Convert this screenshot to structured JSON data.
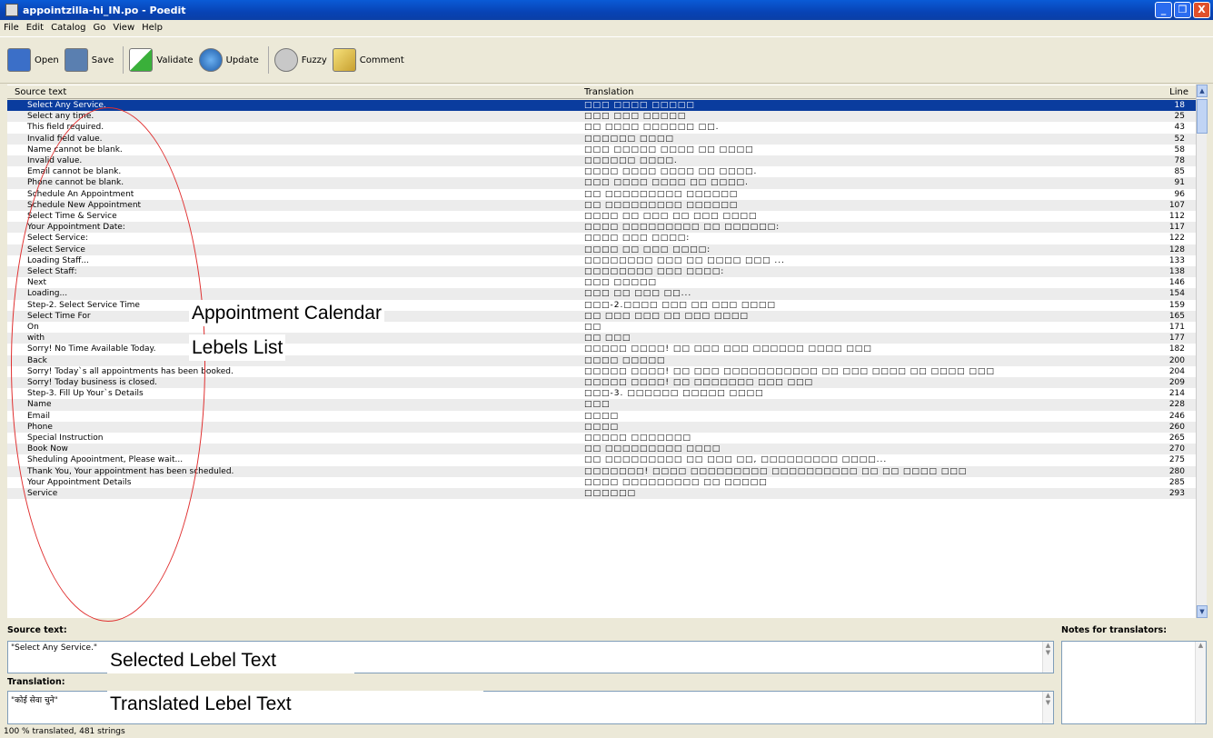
{
  "window": {
    "title": "appointzilla-hi_IN.po - Poedit",
    "controls": [
      "_",
      "❒",
      "X"
    ]
  },
  "menu": [
    "File",
    "Edit",
    "Catalog",
    "Go",
    "View",
    "Help"
  ],
  "toolbar": [
    {
      "label": "Open",
      "icon": "open-folder-icon",
      "cls": "open"
    },
    {
      "label": "Save",
      "icon": "save-icon",
      "cls": "save"
    },
    {
      "label": "Validate",
      "icon": "validate-check-icon",
      "cls": "validate",
      "sep": true
    },
    {
      "label": "Update",
      "icon": "update-globe-icon",
      "cls": "update"
    },
    {
      "label": "Fuzzy",
      "icon": "fuzzy-cloud-icon",
      "cls": "fuzzy",
      "sep": true
    },
    {
      "label": "Comment",
      "icon": "comment-pencil-icon",
      "cls": "comment"
    }
  ],
  "columns": {
    "source": "Source text",
    "translation": "Translation",
    "line": "Line"
  },
  "rows": [
    {
      "src": "Select Any Service.",
      "trn": "□□□ □□□□ □□□□□",
      "ln": "18",
      "selected": true
    },
    {
      "src": "Select any time.",
      "trn": "□□□ □□□ □□□□□",
      "ln": "25"
    },
    {
      "src": "This field required.",
      "trn": "□□ □□□□ □□□□□□ □□.",
      "ln": "43"
    },
    {
      "src": "Invalid field value.",
      "trn": "□□□□□□ □□□□",
      "ln": "52"
    },
    {
      "src": "Name cannot be blank.",
      "trn": "□□□ □□□□□ □□□□ □□ □□□□",
      "ln": "58"
    },
    {
      "src": "Invalid value.",
      "trn": "□□□□□□ □□□□.",
      "ln": "78"
    },
    {
      "src": "Email cannot be blank.",
      "trn": "□□□□ □□□□ □□□□ □□ □□□□.",
      "ln": "85"
    },
    {
      "src": "Phone cannot be blank.",
      "trn": "□□□ □□□□ □□□□ □□ □□□□.",
      "ln": "91"
    },
    {
      "src": "Schedule An Appointment",
      "trn": "□□ □□□□□□□□□ □□□□□□",
      "ln": "96"
    },
    {
      "src": "Schedule New Appointment",
      "trn": "□□ □□□□□□□□□ □□□□□□",
      "ln": "107"
    },
    {
      "src": "Select Time & Service",
      "trn": "□□□□ □□ □□□  □□ □□□ □□□□",
      "ln": "112"
    },
    {
      "src": "Your Appointment Date:",
      "trn": "□□□□ □□□□□□□□□ □□ □□□□□□:",
      "ln": "117"
    },
    {
      "src": "Select Service:",
      "trn": "□□□□ □□□ □□□□:",
      "ln": "122"
    },
    {
      "src": "Select Service",
      "trn": "□□□□ □□ □□□ □□□□:",
      "ln": "128"
    },
    {
      "src": "Loading Staff...",
      "trn": "□□□□□□□□ □□□ □□ □□□□ □□□ ...",
      "ln": "133"
    },
    {
      "src": "Select Staff:",
      "trn": "□□□□□□□□ □□□ □□□□:",
      "ln": "138"
    },
    {
      "src": "Next",
      "trn": "□□□ □□□□□",
      "ln": "146"
    },
    {
      "src": "Loading...",
      "trn": "□□□ □□ □□□ □□...",
      "ln": "154"
    },
    {
      "src": "Step-2. Select Service Time",
      "trn": "□□□-2.□□□□ □□□ □□ □□□ □□□□",
      "ln": "159"
    },
    {
      "src": "Select Time For",
      "trn": "□□ □□□ □□□ □□ □□□ □□□□",
      "ln": "165"
    },
    {
      "src": "On",
      "trn": "□□",
      "ln": "171"
    },
    {
      "src": "with",
      "trn": "□□ □□□",
      "ln": "177"
    },
    {
      "src": "Sorry! No Time Available Today.",
      "trn": "□□□□□ □□□□! □□ □□□ □□□ □□□□□□ □□□□ □□□",
      "ln": "182"
    },
    {
      "src": "Back",
      "trn": "□□□□ □□□□□",
      "ln": "200"
    },
    {
      "src": "Sorry! Today`s all appointments has been booked.",
      "trn": "□□□□□ □□□□! □□ □□□ □□□□□□□□□□□ □□ □□□ □□□□ □□ □□□□ □□□",
      "ln": "204"
    },
    {
      "src": "Sorry! Today business is closed.",
      "trn": "□□□□□ □□□□! □□ □□□□□□□ □□□ □□□",
      "ln": "209"
    },
    {
      "src": "Step-3. Fill Up Your`s Details",
      "trn": "□□□-3. □□□□□□ □□□□□ □□□□",
      "ln": "214"
    },
    {
      "src": "Name",
      "trn": "□□□",
      "ln": "228"
    },
    {
      "src": "Email",
      "trn": "□□□□",
      "ln": "246"
    },
    {
      "src": "Phone",
      "trn": "□□□□",
      "ln": "260"
    },
    {
      "src": "Special Instruction",
      "trn": "□□□□□ □□□□□□□",
      "ln": "265"
    },
    {
      "src": "Book Now",
      "trn": "□□ □□□□□□□□□ □□□□",
      "ln": "270"
    },
    {
      "src": "Sheduling Apoointment, Please wait...",
      "trn": "□□ □□□□□□□□□ □□ □□□ □□, □□□□□□□□□ □□□□...",
      "ln": "275"
    },
    {
      "src": "Thank You, Your appointment has been scheduled.",
      "trn": "□□□□□□□! □□□□ □□□□□□□□□ □□□□□□□□□□ □□ □□ □□□□ □□□",
      "ln": "280"
    },
    {
      "src": "Your Appointment Details",
      "trn": "□□□□ □□□□□□□□□ □□ □□□□□",
      "ln": "285"
    },
    {
      "src": "Service",
      "trn": "□□□□□□",
      "ln": "293"
    }
  ],
  "annotations": {
    "calendar_line1": "Appointment Calendar",
    "calendar_line2": "Lebels List",
    "selected": "Selected Lebel Text",
    "translated": "Translated Lebel Text"
  },
  "editor": {
    "source_label": "Source text:",
    "source_value": "\"Select Any Service.\"",
    "translation_label": "Translation:",
    "translation_value": "\"कोई सेवा चुने\"",
    "notes_label": "Notes for translators:"
  },
  "status": "100 % translated, 481 strings",
  "colors": {
    "selection": "#0a3c9e",
    "annotation_circle": "#e03030",
    "titlebar": "#0a5bd6"
  }
}
